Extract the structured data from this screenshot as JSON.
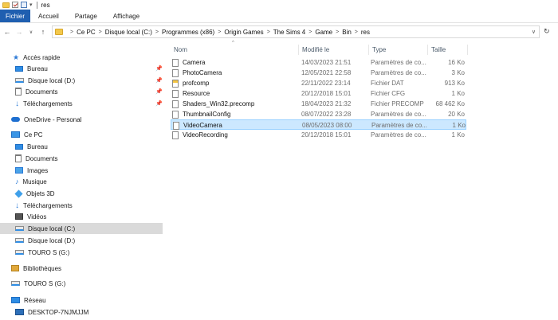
{
  "window": {
    "title": "res"
  },
  "ribbon": {
    "tabs": [
      "Fichier",
      "Accueil",
      "Partage",
      "Affichage"
    ]
  },
  "address": {
    "crumbs": [
      "Ce PC",
      "Disque local (C:)",
      "Programmes (x86)",
      "Origin Games",
      "The Sims 4",
      "Game",
      "Bin",
      "res"
    ]
  },
  "nav": {
    "quick_access": "Accès rapide",
    "quick_items": [
      "Bureau",
      "Disque local (D:)",
      "Documents",
      "Téléchargements"
    ],
    "onedrive": "OneDrive - Personal",
    "this_pc": "Ce PC",
    "pc_items": [
      "Bureau",
      "Documents",
      "Images",
      "Musique",
      "Objets 3D",
      "Téléchargements",
      "Vidéos",
      "Disque local (C:)",
      "Disque local (D:)",
      "TOURO S (G:)"
    ],
    "libraries": "Bibliothèques",
    "touro": "TOURO S (G:)",
    "network": "Réseau",
    "desktop": "DESKTOP-7NJMJJM"
  },
  "columns": {
    "name": "Nom",
    "modified": "Modifié le",
    "type": "Type",
    "size": "Taille"
  },
  "files": [
    {
      "name": "Camera",
      "date": "14/03/2023 21:51",
      "type": "Paramètres de co...",
      "size": "16 Ko"
    },
    {
      "name": "PhotoCamera",
      "date": "12/05/2021 22:58",
      "type": "Paramètres de co...",
      "size": "3 Ko"
    },
    {
      "name": "profcomp",
      "date": "22/11/2022 23:14",
      "type": "Fichier DAT",
      "size": "913 Ko"
    },
    {
      "name": "Resource",
      "date": "20/12/2018 15:01",
      "type": "Fichier CFG",
      "size": "1 Ko"
    },
    {
      "name": "Shaders_Win32.precomp",
      "date": "18/04/2023 21:32",
      "type": "Fichier PRECOMP",
      "size": "68 462 Ko"
    },
    {
      "name": "ThumbnailConfig",
      "date": "08/07/2022 23:28",
      "type": "Paramètres de co...",
      "size": "20 Ko"
    },
    {
      "name": "VideoCamera",
      "date": "08/05/2023 08:00",
      "type": "Paramètres de co...",
      "size": "1 Ko"
    },
    {
      "name": "VideoRecording",
      "date": "20/12/2018 15:01",
      "type": "Paramètres de co...",
      "size": "1 Ko"
    }
  ],
  "colors": {
    "accent": "#1f5fb0",
    "selection": "#cce8ff",
    "nav_selection": "#dadada"
  }
}
